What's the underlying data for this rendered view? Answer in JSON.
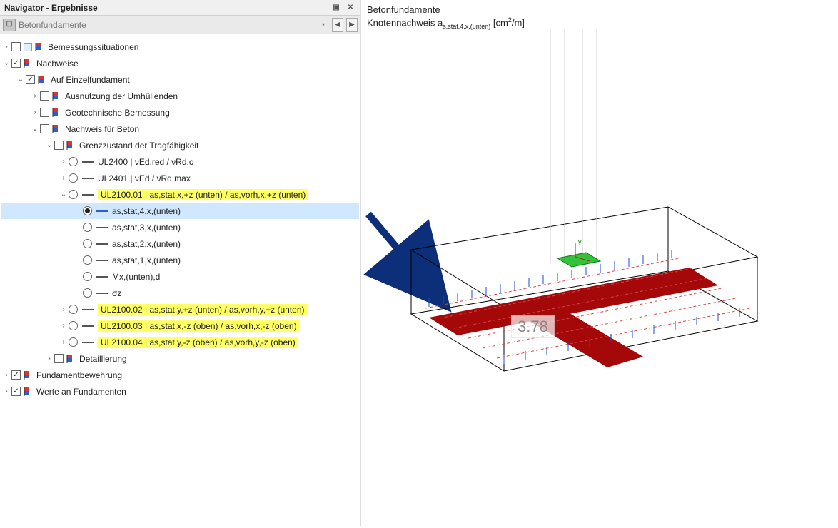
{
  "panel": {
    "title": "Navigator - Ergebnisse",
    "toolbar_text": "Betonfundamente"
  },
  "tree": {
    "n0": "Bemessungssituationen",
    "n1": "Nachweise",
    "n1_0": "Auf Einzelfundament",
    "n1_0_0": "Ausnutzung der Umhüllenden",
    "n1_0_1": "Geotechnische Bemessung",
    "n1_0_2": "Nachweis für Beton",
    "n1_0_2_0": "Grenzzustand der Tragfähigkeit",
    "ul2400": "UL2400 | νEd,red / νRd,c",
    "ul2401": "UL2401 | νEd / νRd,max",
    "ul2100_01": "UL2100.01 | as,stat,x,+z (unten) / as,vorh,x,+z (unten)",
    "as4": "as,stat,4,x,(unten)",
    "as3": "as,stat,3,x,(unten)",
    "as2": "as,stat,2,x,(unten)",
    "as1": "as,stat,1,x,(unten)",
    "mx": "Mx,(unten),d",
    "sigmaz": "σz",
    "ul2100_02": "UL2100.02 | as,stat,y,+z (unten) / as,vorh,y,+z (unten)",
    "ul2100_03": "UL2100.03 | as,stat,x,-z (oben) / as,vorh,x,-z (oben)",
    "ul2100_04": "UL2100.04 | as,stat,y,-z (oben) / as,vorh,y,-z (oben)",
    "detail": "Detaillierung",
    "n2": "Fundamentbewehrung",
    "n3": "Werte an Fundamenten"
  },
  "viewport": {
    "title": "Betonfundamente",
    "subtitle_a": "Knotennachweis a",
    "subtitle_sub": "s,stat,4,x,(unten)",
    "subtitle_unit_a": " [cm",
    "subtitle_unit_sup": "2",
    "subtitle_unit_b": "/m]",
    "value": "3.78"
  }
}
